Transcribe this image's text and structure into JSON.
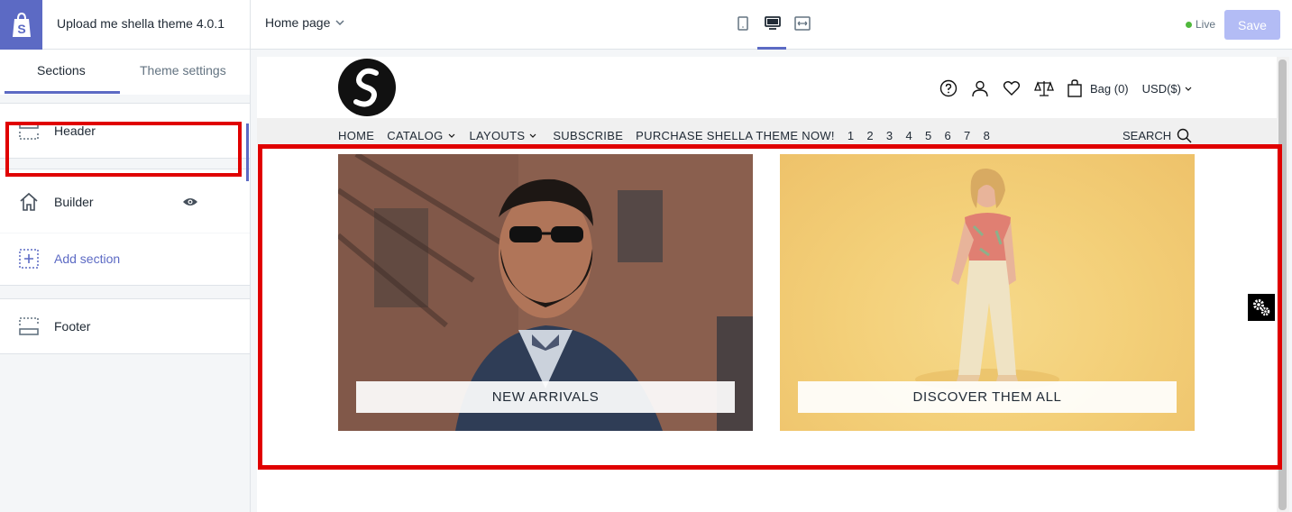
{
  "topbar": {
    "theme_name": "Upload me shella theme 4.0.1",
    "page_select": "Home page",
    "device_icons": [
      "mobile-icon",
      "desktop-icon",
      "fullscreen-icon"
    ],
    "live_label": "Live",
    "save_label": "Save"
  },
  "sidebar": {
    "tabs": [
      {
        "label": "Sections",
        "active": true
      },
      {
        "label": "Theme settings",
        "active": false
      }
    ],
    "header_label": "Header",
    "builder_label": "Builder",
    "add_section_label": "Add section",
    "footer_label": "Footer"
  },
  "store": {
    "bag_label": "Bag (0)",
    "currency": "USD($)",
    "nav": [
      "HOME",
      "CATALOG",
      "LAYOUTS",
      "SUBSCRIBE",
      "PURCHASE SHELLA THEME NOW!",
      "1",
      "2",
      "3",
      "4",
      "5",
      "6",
      "7",
      "8"
    ],
    "search_label": "SEARCH",
    "banners": [
      {
        "label": "NEW ARRIVALS"
      },
      {
        "label": "DISCOVER THEM ALL"
      }
    ]
  },
  "colors": {
    "accent": "#5c6ac4",
    "highlight": "#e00000",
    "live": "#50b83c"
  }
}
